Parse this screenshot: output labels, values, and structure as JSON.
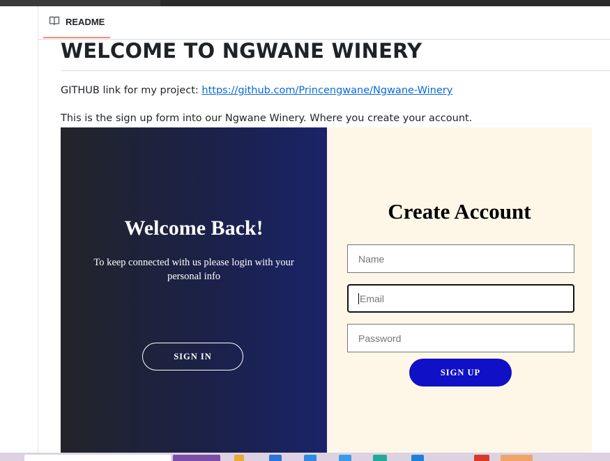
{
  "readme_tab": {
    "label": "README",
    "icon": "book-icon"
  },
  "readme": {
    "heading": "WELCOME TO NGWANE WINERY",
    "github_prefix": "GITHUB link for my project: ",
    "github_link": "https://github.com/Princengwane/Ngwane-Winery",
    "description": "This is the sign up form into our Ngwane Winery. Where you create your account."
  },
  "signup_form": {
    "left": {
      "title": "Welcome Back!",
      "subtitle": "To keep connected with us please login with your personal info",
      "signin_label": "SIGN IN"
    },
    "right": {
      "title": "Create Account",
      "name_placeholder": "Name",
      "email_placeholder": "Email",
      "password_placeholder": "Password",
      "signup_label": "SIGN UP"
    }
  },
  "colors": {
    "link": "#0969da",
    "signup_button": "#1010c6",
    "right_panel_bg": "#fef7e8",
    "left_panel_gradient_end": "#1a2468",
    "tab_underline": "#fd8c73"
  }
}
